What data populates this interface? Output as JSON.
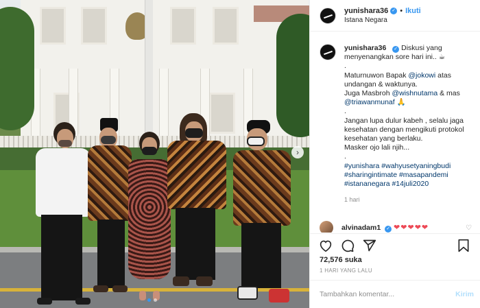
{
  "post": {
    "username": "yunishara36",
    "follow_label": "Ikuti",
    "location": "Istana Negara",
    "separator": "•"
  },
  "caption": {
    "username": "yunishara36",
    "lines": [
      "Diskusi yang menyenangkan sore hari ini.. ☕",
      ".",
      "Maturnuwon Bapak ",
      "@jokowi",
      " atas undangan & waktunya.",
      "Juga Masbroh ",
      "@wishnutama",
      " & mas ",
      "@triawanmunaf",
      " 🙏",
      ".",
      "Jangan lupa dulur kabeh , selalu jaga kesehatan dengan mengikuti protokol kesehatan yang berlaku.",
      "Masker ojo lali njih...",
      ".",
      "#yunishara #wahyusetyaningbudi #sharingintimate #masapandemi #istananegara #14juli2020"
    ],
    "time_ago": "1 hari"
  },
  "comment": {
    "username": "alvinadam1",
    "hearts": "❤❤❤❤❤"
  },
  "actions": {
    "like_icon": "heart-icon",
    "comment_icon": "comment-icon",
    "share_icon": "share-icon",
    "save_icon": "bookmark-icon"
  },
  "likes": "72,576 suka",
  "date": "1 HARI YANG LALU",
  "add_comment": {
    "placeholder": "Tambahkan komentar...",
    "post_label": "Kirim"
  },
  "carousel": {
    "next_icon": "chevron-right-icon"
  },
  "colors": {
    "accent": "#3897f0",
    "heart": "#ed4956",
    "hashtag": "#00376b"
  }
}
